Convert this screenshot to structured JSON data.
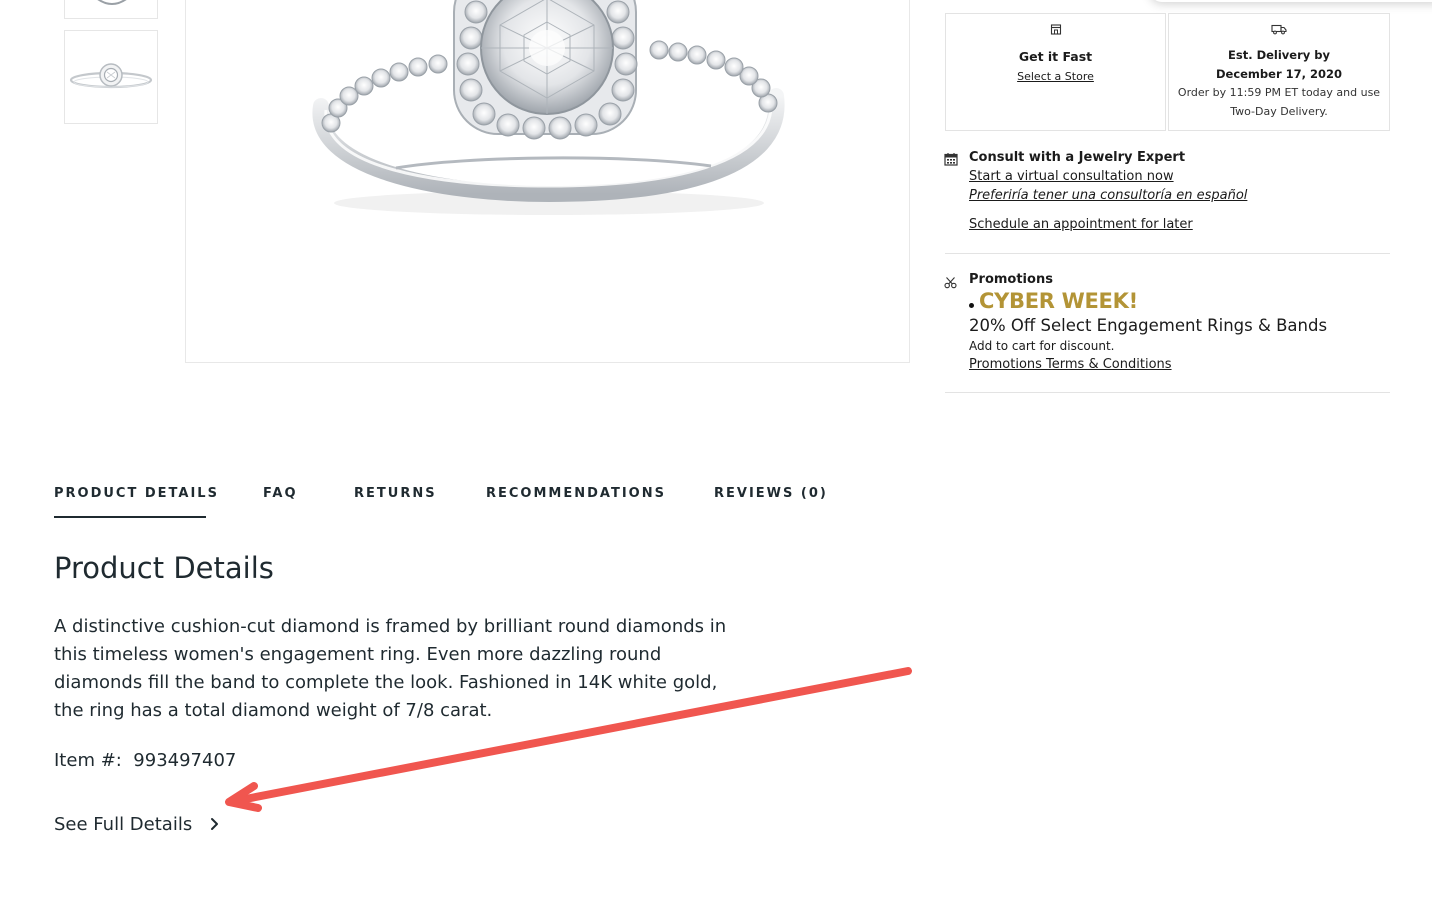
{
  "fulfillment": {
    "store": {
      "icon": "store-icon",
      "title": "Get it Fast",
      "link": "Select a Store"
    },
    "delivery": {
      "icon": "truck-icon",
      "line1": "Est. Delivery by",
      "line2": "December 17, 2020",
      "line3": "Order by 11:59 PM ET today and use",
      "line4": "Two-Day Delivery."
    }
  },
  "consult": {
    "icon": "calendar-icon",
    "title": "Consult with a Jewelry Expert",
    "link_virtual": "Start a virtual consultation now",
    "link_spanish": "Preferiría tener una consultoría en español",
    "link_schedule": "Schedule an appointment for later"
  },
  "promotions": {
    "icon": "scissors-icon",
    "title": "Promotions",
    "badge": "CYBER WEEK!",
    "headline": "20% Off Select Engagement Rings & Bands",
    "note": "Add to cart for discount.",
    "terms_link": "Promotions Terms & Conditions",
    "badge_color": "#b39436"
  },
  "tabs": [
    {
      "label": "PRODUCT DETAILS",
      "active": true
    },
    {
      "label": "FAQ"
    },
    {
      "label": "RETURNS"
    },
    {
      "label": "RECOMMENDATIONS"
    },
    {
      "label": "REVIEWS (0)"
    }
  ],
  "details": {
    "heading": "Product Details",
    "description": "A distinctive cushion-cut diamond is framed by brilliant round diamonds in this timeless women's engagement ring. Even more dazzling round diamonds fill the band to complete the look. Fashioned in 14K white gold, the ring has a total diamond weight of 7/8 carat.",
    "item_label": "Item #:",
    "item_number": "993497407",
    "see_full_label": "See Full Details"
  },
  "annotation": {
    "arrow_color": "#f0564f"
  }
}
